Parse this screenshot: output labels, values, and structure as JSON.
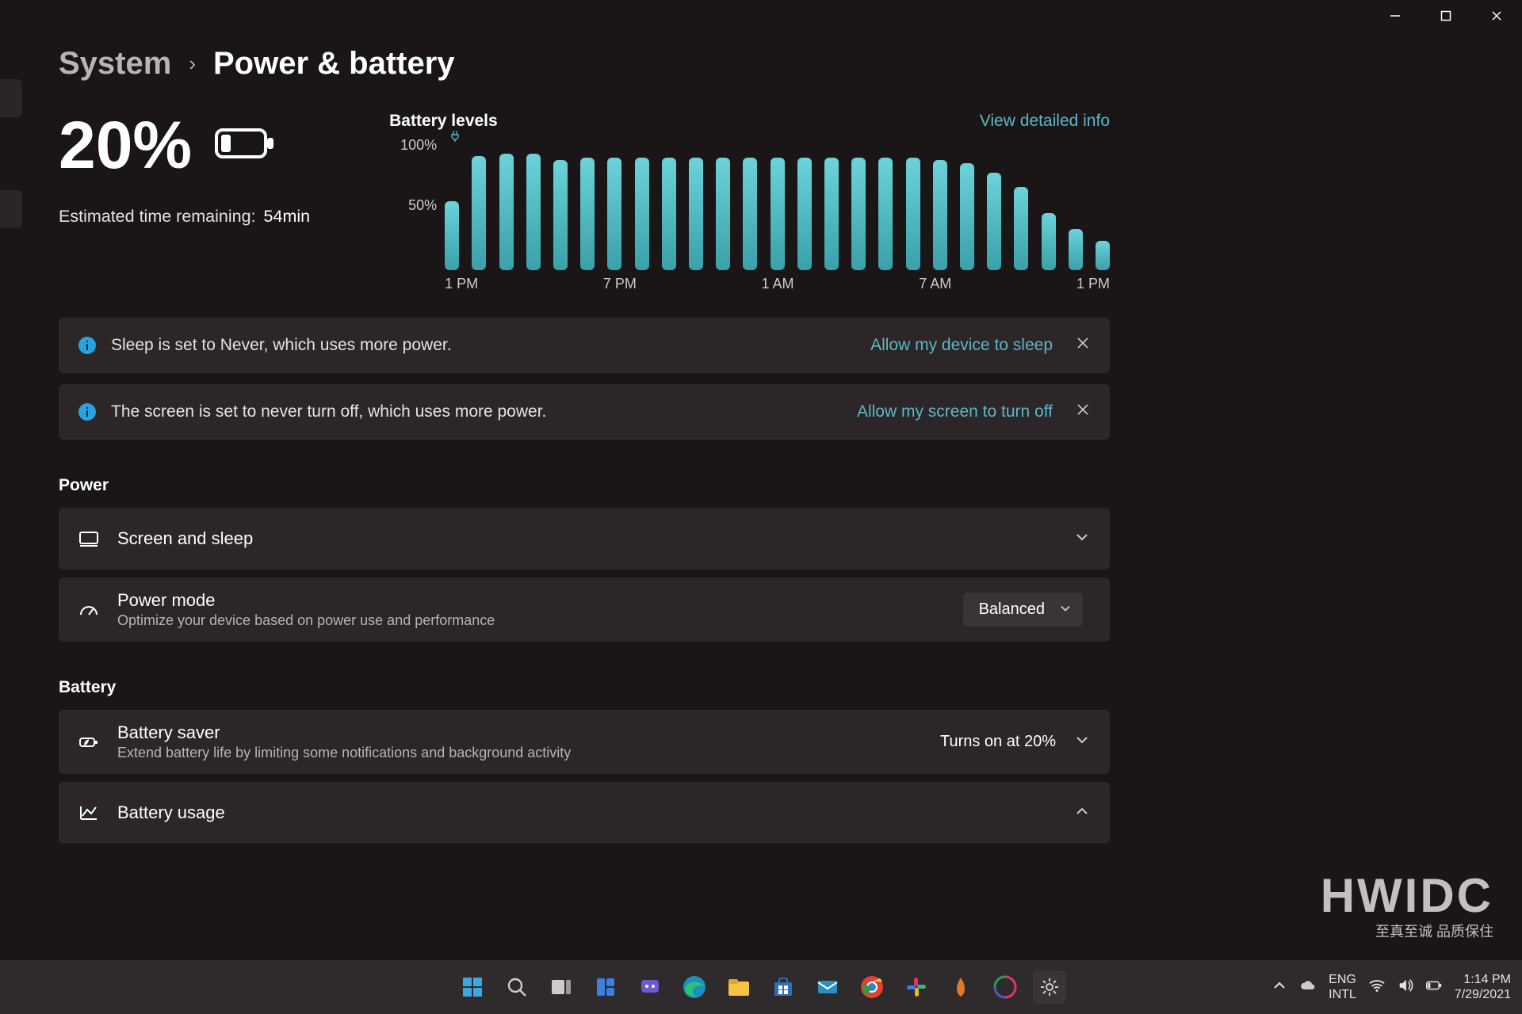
{
  "breadcrumb": {
    "parent": "System",
    "current": "Power & battery"
  },
  "battery": {
    "percent_text": "20%",
    "time_label": "Estimated time remaining:",
    "time_value": "54min"
  },
  "chart": {
    "title": "Battery levels",
    "link": "View detailed info",
    "y100": "100%",
    "y50": "50%",
    "ticks": [
      "1 PM",
      "7 PM",
      "1 AM",
      "7 AM",
      "1 PM"
    ]
  },
  "chart_data": {
    "type": "bar",
    "title": "Battery levels",
    "xlabel": "",
    "ylabel": "%",
    "ylim": [
      0,
      100
    ],
    "categories_shown": [
      "1 PM",
      "7 PM",
      "1 AM",
      "7 AM",
      "1 PM"
    ],
    "values": [
      58,
      96,
      98,
      98,
      93,
      95,
      95,
      95,
      95,
      95,
      95,
      95,
      95,
      95,
      95,
      95,
      95,
      95,
      93,
      90,
      82,
      70,
      48,
      35,
      25
    ]
  },
  "banners": {
    "sleep": {
      "text": "Sleep is set to Never, which uses more power.",
      "action": "Allow my device to sleep"
    },
    "screen": {
      "text": "The screen is set to never turn off, which uses more power.",
      "action": "Allow my screen to turn off"
    }
  },
  "sections": {
    "power": "Power",
    "battery": "Battery"
  },
  "rows": {
    "screen_sleep": {
      "title": "Screen and sleep"
    },
    "power_mode": {
      "title": "Power mode",
      "subtitle": "Optimize your device based on power use and performance",
      "value": "Balanced"
    },
    "battery_saver": {
      "title": "Battery saver",
      "subtitle": "Extend battery life by limiting some notifications and background activity",
      "value": "Turns on at 20%"
    },
    "battery_usage": {
      "title": "Battery usage"
    }
  },
  "watermark": {
    "big": "HWIDC",
    "small": "至真至诚 品质保住"
  },
  "taskbar": {
    "chevup": "⌃",
    "lang1": "ENG",
    "lang2": "INTL",
    "time": "1:14 PM",
    "date": "7/29/2021"
  }
}
